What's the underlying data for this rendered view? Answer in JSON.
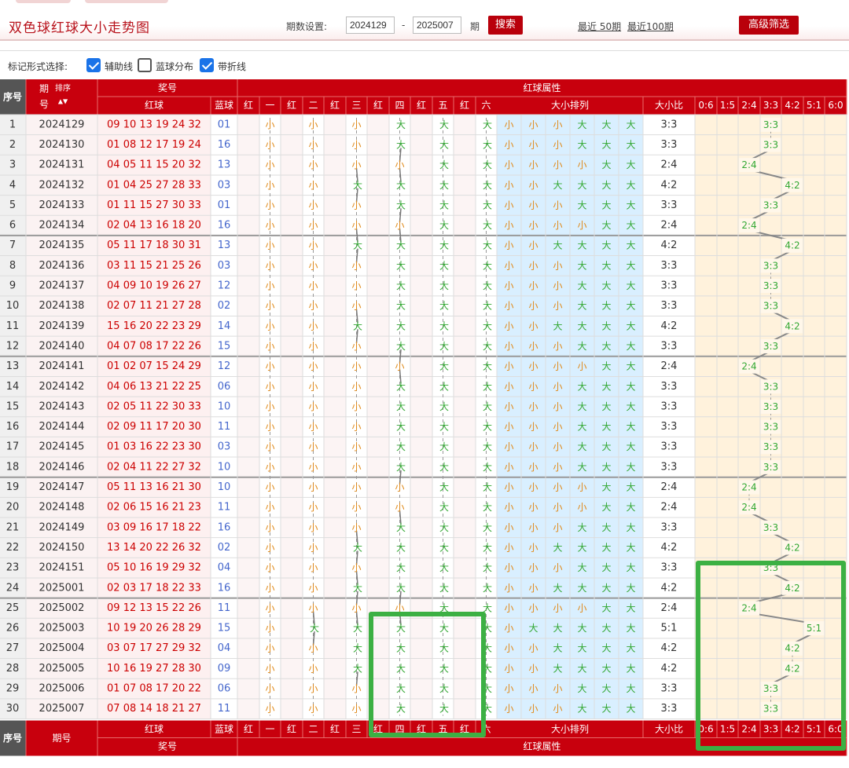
{
  "title": "双色球红球大小走势图",
  "period_label": "期数设置:",
  "period_from": "2024129",
  "period_sep": "-",
  "period_to": "2025007",
  "period_unit": "期",
  "search_btn": "搜索",
  "recent50": "最近 50期",
  "recent100": "最近100期",
  "advanced_btn": "高级筛选",
  "mark_label": "标记形式选择:",
  "opt1": "辅助线",
  "opt2": "蓝球分布",
  "opt3": "带折线",
  "head": {
    "seq": "序号",
    "issue": "期号",
    "sort": "排序",
    "prize": "奖号",
    "red_attr": "红球属性",
    "red": "红球",
    "blue": "蓝球",
    "positions": [
      "红",
      "一",
      "红",
      "二",
      "红",
      "三",
      "红",
      "四",
      "红",
      "五",
      "红",
      "六"
    ],
    "order": "大小排列",
    "ratio": "大小比",
    "ratios": [
      "0:6",
      "1:5",
      "2:4",
      "3:3",
      "4:2",
      "5:1",
      "6:0"
    ]
  },
  "colors": {
    "red": "#cc0000",
    "green": "#33a833",
    "orange": "#e08a1a",
    "blue": "#4466cc"
  },
  "rows": [
    [
      "1",
      "2024129",
      "09 10 13 19 24 32",
      "01",
      "小小小大大大",
      "3:3"
    ],
    [
      "2",
      "2024130",
      "01 08 12 17 19 24",
      "16",
      "小小小大大大",
      "3:3"
    ],
    [
      "3",
      "2024131",
      "04 05 11 15 20 32",
      "13",
      "小小小小大大",
      "2:4"
    ],
    [
      "4",
      "2024132",
      "01 04 25 27 28 33",
      "03",
      "小小大大大大",
      "4:2"
    ],
    [
      "5",
      "2024133",
      "01 11 15 27 30 33",
      "01",
      "小小小大大大",
      "3:3"
    ],
    [
      "6",
      "2024134",
      "02 04 13 16 18 20",
      "16",
      "小小小小大大",
      "2:4"
    ],
    [
      "7",
      "2024135",
      "05 11 17 18 30 31",
      "13",
      "小小大大大大",
      "4:2"
    ],
    [
      "8",
      "2024136",
      "03 11 15 21 25 26",
      "03",
      "小小小大大大",
      "3:3"
    ],
    [
      "9",
      "2024137",
      "04 09 10 19 26 27",
      "12",
      "小小小大大大",
      "3:3"
    ],
    [
      "10",
      "2024138",
      "02 07 11 21 27 28",
      "02",
      "小小小大大大",
      "3:3"
    ],
    [
      "11",
      "2024139",
      "15 16 20 22 23 29",
      "14",
      "小小大大大大",
      "4:2"
    ],
    [
      "12",
      "2024140",
      "04 07 08 17 22 26",
      "15",
      "小小小大大大",
      "3:3"
    ],
    [
      "13",
      "2024141",
      "01 02 07 15 24 29",
      "12",
      "小小小小大大",
      "2:4"
    ],
    [
      "14",
      "2024142",
      "04 06 13 21 22 25",
      "06",
      "小小小大大大",
      "3:3"
    ],
    [
      "15",
      "2024143",
      "02 05 11 22 30 33",
      "10",
      "小小小大大大",
      "3:3"
    ],
    [
      "16",
      "2024144",
      "02 09 11 17 20 30",
      "11",
      "小小小大大大",
      "3:3"
    ],
    [
      "17",
      "2024145",
      "01 03 16 22 23 30",
      "03",
      "小小小大大大",
      "3:3"
    ],
    [
      "18",
      "2024146",
      "02 04 11 22 27 32",
      "10",
      "小小小大大大",
      "3:3"
    ],
    [
      "19",
      "2024147",
      "05 11 13 16 21 30",
      "10",
      "小小小小大大",
      "2:4"
    ],
    [
      "20",
      "2024148",
      "02 06 15 16 21 23",
      "11",
      "小小小小大大",
      "2:4"
    ],
    [
      "21",
      "2024149",
      "03 09 16 17 18 22",
      "16",
      "小小小大大大",
      "3:3"
    ],
    [
      "22",
      "2024150",
      "13 14 20 22 26 32",
      "02",
      "小小大大大大",
      "4:2"
    ],
    [
      "23",
      "2024151",
      "05 10 16 19 29 32",
      "04",
      "小小小大大大",
      "3:3"
    ],
    [
      "24",
      "2025001",
      "02 03 17 18 22 33",
      "16",
      "小小大大大大",
      "4:2"
    ],
    [
      "25",
      "2025002",
      "09 12 13 15 22 26",
      "11",
      "小小小小大大",
      "2:4"
    ],
    [
      "26",
      "2025003",
      "10 19 20 26 28 29",
      "15",
      "小大大大大大",
      "5:1"
    ],
    [
      "27",
      "2025004",
      "03 07 17 27 29 32",
      "04",
      "小小大大大大",
      "4:2"
    ],
    [
      "28",
      "2025005",
      "10 16 19 27 28 30",
      "09",
      "小小大大大大",
      "4:2"
    ],
    [
      "29",
      "2025006",
      "01 07 08 17 20 22",
      "06",
      "小小小大大大",
      "3:3"
    ],
    [
      "30",
      "2025007",
      "07 08 14 18 21 27",
      "11",
      "小小小大大大",
      "3:3"
    ]
  ]
}
